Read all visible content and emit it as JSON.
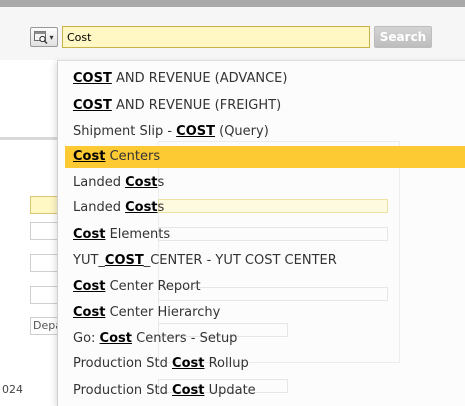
{
  "search": {
    "value": "Cost",
    "button_label": "Search"
  },
  "background": {
    "select_value": "Department",
    "value_fragment": "024"
  },
  "dropdown": {
    "highlighted_index": 3,
    "items": [
      {
        "parts": [
          {
            "t": "COST",
            "m": true
          },
          {
            "t": " AND REVENUE (ADVANCE)",
            "m": false
          }
        ]
      },
      {
        "parts": [
          {
            "t": "COST",
            "m": true
          },
          {
            "t": " AND REVENUE (FREIGHT)",
            "m": false
          }
        ]
      },
      {
        "parts": [
          {
            "t": "Shipment Slip - ",
            "m": false
          },
          {
            "t": "COST",
            "m": true
          },
          {
            "t": " (Query)",
            "m": false
          }
        ]
      },
      {
        "parts": [
          {
            "t": "Cost",
            "m": true
          },
          {
            "t": " Centers",
            "m": false
          }
        ]
      },
      {
        "parts": [
          {
            "t": "Landed ",
            "m": false
          },
          {
            "t": "Cost",
            "m": true
          },
          {
            "t": "s",
            "m": false
          }
        ]
      },
      {
        "parts": [
          {
            "t": "Landed ",
            "m": false
          },
          {
            "t": "Cost",
            "m": true
          },
          {
            "t": "s",
            "m": false
          }
        ]
      },
      {
        "parts": [
          {
            "t": "Cost",
            "m": true
          },
          {
            "t": " Elements",
            "m": false
          }
        ]
      },
      {
        "parts": [
          {
            "t": "YUT_",
            "m": false
          },
          {
            "t": "COST",
            "m": true
          },
          {
            "t": "_CENTER - YUT COST CENTER",
            "m": false
          }
        ]
      },
      {
        "parts": [
          {
            "t": "Cost",
            "m": true
          },
          {
            "t": " Center Report",
            "m": false
          }
        ]
      },
      {
        "parts": [
          {
            "t": "Cost",
            "m": true
          },
          {
            "t": " Center Hierarchy",
            "m": false
          }
        ]
      },
      {
        "parts": [
          {
            "t": "Go: ",
            "m": false
          },
          {
            "t": "Cost",
            "m": true
          },
          {
            "t": " Centers - Setup",
            "m": false
          }
        ]
      },
      {
        "parts": [
          {
            "t": "Production Std ",
            "m": false
          },
          {
            "t": "Cost",
            "m": true
          },
          {
            "t": " Rollup",
            "m": false
          }
        ]
      },
      {
        "parts": [
          {
            "t": "Production Std ",
            "m": false
          },
          {
            "t": "Cost",
            "m": true
          },
          {
            "t": " Update",
            "m": false
          }
        ]
      }
    ]
  },
  "icons": {
    "lookup": "lookup-window-icon"
  },
  "colors": {
    "highlight": "#fdca34",
    "input_bg": "#fff7c4"
  }
}
